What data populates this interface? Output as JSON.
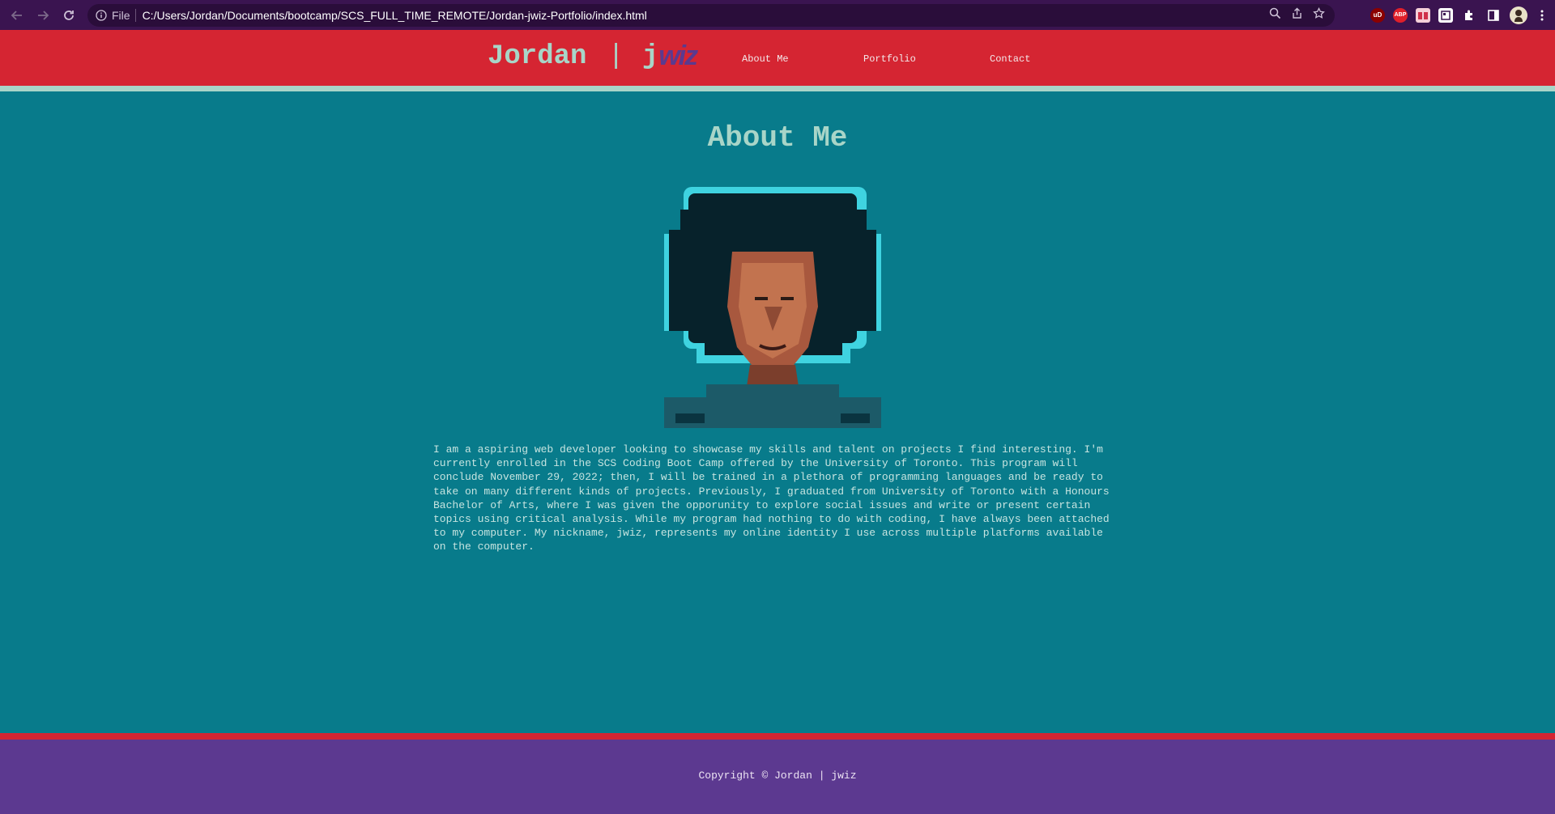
{
  "browser": {
    "scheme_label": "File",
    "url": "C:/Users/Jordan/Documents/bootcamp/SCS_FULL_TIME_REMOTE/Jordan-jwiz-Portfolio/index.html",
    "toolbar_icons": [
      "back-arrow-icon",
      "forward-arrow-icon",
      "reload-icon",
      "info-icon",
      "zoom-icon",
      "share-icon",
      "star-icon"
    ],
    "extensions": [
      {
        "name": "ublock",
        "label": "uD",
        "color": "#8b0000"
      },
      {
        "name": "adblock-plus",
        "label": "ABP",
        "color": "#e0202a"
      },
      {
        "name": "extension-red",
        "label": "",
        "color": "#e04a6a"
      },
      {
        "name": "extension-box",
        "label": "",
        "color": "#ffffff"
      }
    ]
  },
  "header": {
    "brand_name": "Jordan",
    "brand_separator": "|",
    "brand_j": "j",
    "brand_wiz": "wiz",
    "nav": [
      {
        "label": "About Me"
      },
      {
        "label": "Portfolio"
      },
      {
        "label": "Contact"
      }
    ]
  },
  "main": {
    "title": "About Me",
    "bio": "I am a aspiring web developer looking to showcase my skills and talent on projects I find interesting. I'm currently enrolled in the SCS Coding Boot Camp offered by the University of Toronto. This program will conclude November 29, 2022; then, I will be trained in a plethora of programming languages and be ready to take on many different kinds of projects. Previously, I graduated from University of Toronto with a Honours Bachelor of Arts, where I was given the opporunity to explore social issues and write or present certain topics using critical analysis. While my program had nothing to do with coding, I have always been attached to my computer. My nickname, jwiz, represents my online identity I use across multiple platforms available on the computer."
  },
  "footer": {
    "copyright": "Copyright © Jordan | jwiz"
  },
  "colors": {
    "background": "#087b8b",
    "header": "#d52532",
    "accent": "#a8d5c8",
    "footer": "#5c3990",
    "chrome": "#3a1450"
  }
}
